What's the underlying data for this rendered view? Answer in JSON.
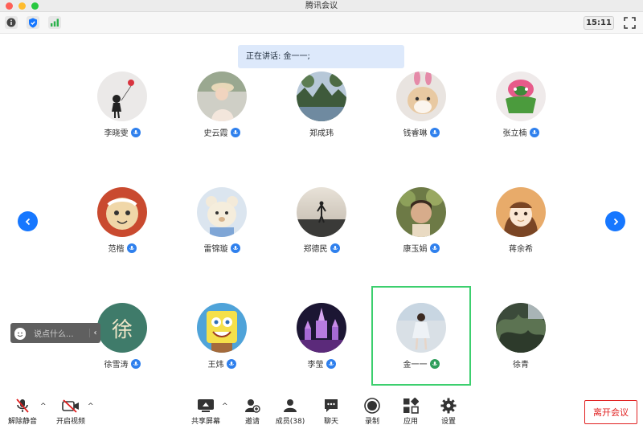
{
  "window": {
    "title": "腾讯会议"
  },
  "toolbar": {
    "time": "15:11"
  },
  "speaker": {
    "label": "正在讲话: 金一一;"
  },
  "participants": [
    {
      "name": "李晓雯",
      "mic": "on"
    },
    {
      "name": "史云霞",
      "mic": "on"
    },
    {
      "name": "郑成玮",
      "mic": "none"
    },
    {
      "name": "钱睿琳",
      "mic": "on"
    },
    {
      "name": "张立楠",
      "mic": "on"
    },
    {
      "name": "范楷",
      "mic": "on"
    },
    {
      "name": "雷锦璇",
      "mic": "on"
    },
    {
      "name": "郑德民",
      "mic": "on"
    },
    {
      "name": "康玉娟",
      "mic": "on"
    },
    {
      "name": "蒋余希",
      "mic": "none"
    },
    {
      "name": "徐雪涛",
      "mic": "on"
    },
    {
      "name": "王炜",
      "mic": "on"
    },
    {
      "name": "李莹",
      "mic": "on"
    },
    {
      "name": "金一一",
      "mic": "speaking"
    },
    {
      "name": "徐青",
      "mic": "none"
    }
  ],
  "chat": {
    "placeholder": "说点什么..."
  },
  "bottom": {
    "unmute": "解除静音",
    "start_video": "开启视频",
    "share_screen": "共享屏幕",
    "invite": "邀请",
    "members": "成员(38)",
    "chat": "聊天",
    "record": "录制",
    "apps": "应用",
    "settings": "设置",
    "leave": "离开会议"
  },
  "colors": {
    "accent": "#1677ff",
    "leave": "#e02020",
    "highlight": "#3ccf6e"
  }
}
